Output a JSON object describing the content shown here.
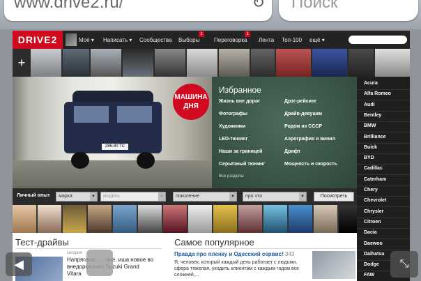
{
  "browser": {
    "url": "www.drive2.ru/",
    "search_placeholder": "Поиск"
  },
  "site": {
    "logo": "DRIVE2",
    "nav": [
      {
        "label": "Моё ▾"
      },
      {
        "label": "Написать ▾"
      },
      {
        "label": "Сообщества"
      },
      {
        "label": "Выборы",
        "badge": "1"
      },
      {
        "label": "Переговорка",
        "badge": "1"
      },
      {
        "label": "Лента"
      },
      {
        "label": "Топ-100"
      },
      {
        "label": "ещё ▾"
      }
    ]
  },
  "hero": {
    "badge_line1": "МАШИНА",
    "badge_line2": "ДНЯ",
    "plate": "286-80 TC"
  },
  "featured": {
    "title": "Избранное",
    "left": [
      "Жизнь вне дорог",
      "Фотографы",
      "Художники",
      "LED-тюнинг",
      "Наши за границей",
      "Серьёзный тюнинг"
    ],
    "right": [
      "Дрэг-рейсинг",
      "Драйв-девушки",
      "Родом из СССР",
      "Аэрография и винил",
      "Дрифт",
      "Мощность и скорость"
    ],
    "all_link": "Все разделы"
  },
  "brands": [
    "Acura",
    "Alfa Romeo",
    "Audi",
    "Bentley",
    "BMW",
    "Brilliance",
    "Buick",
    "BYD",
    "Cadillac",
    "Caterham",
    "Chery",
    "Chevrolet",
    "Chrysler",
    "Citroen",
    "Dacia",
    "Daewoo",
    "Daihatsu",
    "Dodge",
    "FAW"
  ],
  "filters": {
    "label": "Личный опыт",
    "make": "марка",
    "model": "модель",
    "generation": "поколение",
    "topic": "про что",
    "button": "Посмотреть"
  },
  "testdrives": {
    "title": "Тест-драйвы",
    "date": "сегодня",
    "text": "Напрягаем... ...ние, иша новое во внедорожнике Suzuki Grand Vitara"
  },
  "popular": {
    "title": "Самое популярное",
    "link": "Правда про пленку и Одесский сервис!",
    "count": "343",
    "text": "Я, человек, который каждый день работает с людьми, сфера тяжелая, уходить клиентам с каждым годом все сложней,..."
  },
  "colors": {
    "brand_red": "#d10a1f",
    "nav_bg": "#232323",
    "board_green": "#3f5a4b",
    "link_blue": "#1a5ea8"
  }
}
